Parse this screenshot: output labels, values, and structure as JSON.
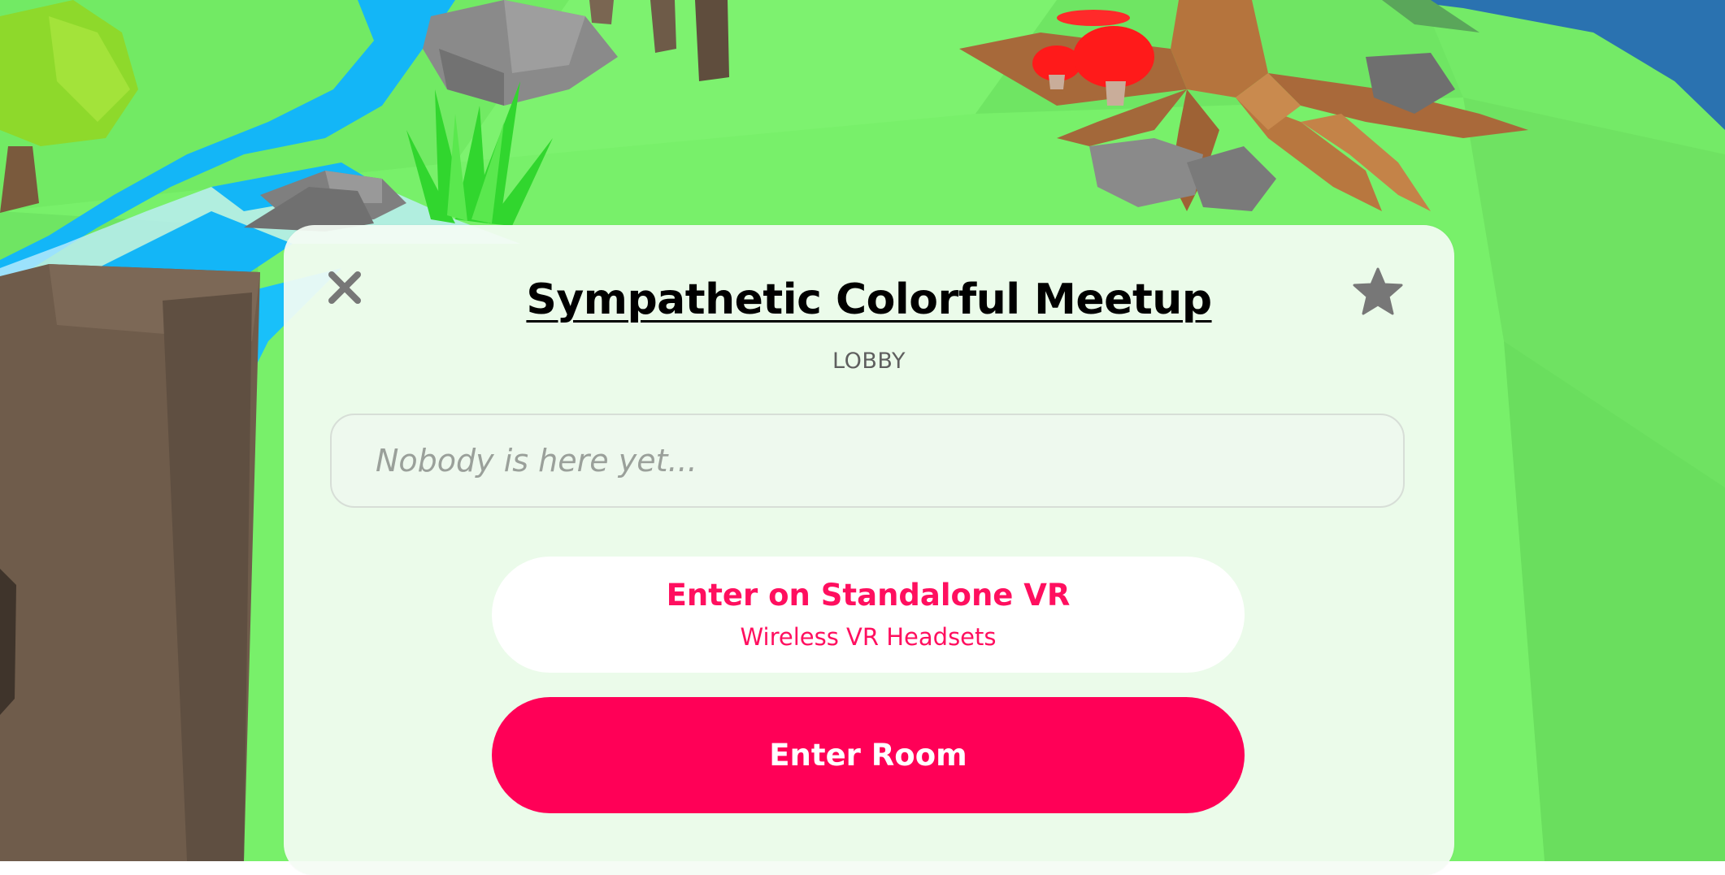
{
  "room": {
    "title": "Sympathetic Colorful Meetup",
    "subtitle": "LOBBY",
    "presence_placeholder": "Nobody is here yet..."
  },
  "actions": {
    "close_icon": "close-icon",
    "favorite_icon": "star-icon",
    "vr_label": "Enter on Standalone VR",
    "vr_sublabel": "Wireless VR Headsets",
    "enter_label": "Enter Room"
  },
  "colors": {
    "accent": "#ff0057",
    "panel_bg": "#f4fcf4",
    "icon_gray": "#777777",
    "grass": "#78f06a",
    "river": "#13b6f7",
    "water_top_right": "#2a72b0"
  }
}
